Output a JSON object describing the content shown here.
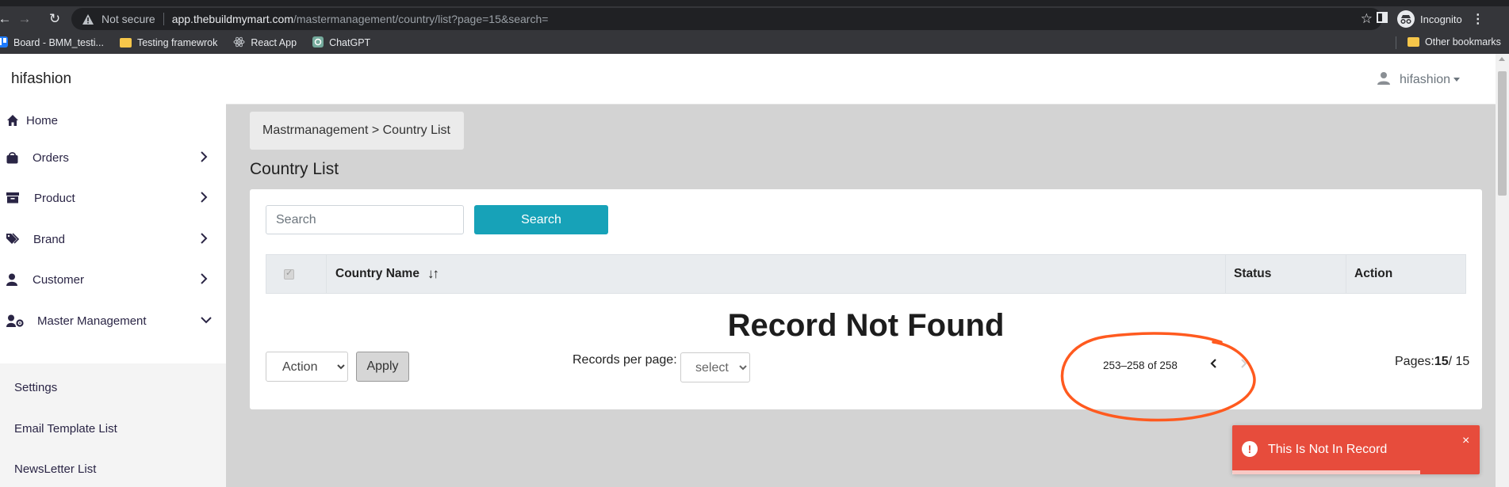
{
  "browser": {
    "security_text": "Not secure",
    "url_host": "app.thebuildmymart.com",
    "url_path": "/mastermanagement/country/list?page=15&search=",
    "profile_label": "Incognito",
    "bookmarks": [
      {
        "label": "Board - BMM_testi...",
        "icon": "trello-icon"
      },
      {
        "label": "Testing framewrok",
        "icon": "folder-icon"
      },
      {
        "label": "React App",
        "icon": "react-icon"
      },
      {
        "label": "ChatGPT",
        "icon": "chatgpt-icon"
      }
    ],
    "other_bookmarks": "Other bookmarks"
  },
  "header": {
    "brand": "hifashion",
    "user_name": "hifashion"
  },
  "sidebar": {
    "items": [
      {
        "label": "Home",
        "icon": "home-icon"
      },
      {
        "label": "Orders",
        "icon": "shopping-bag-icon"
      },
      {
        "label": "Product",
        "icon": "archive-box-icon"
      },
      {
        "label": "Brand",
        "icon": "tags-icon"
      },
      {
        "label": "Customer",
        "icon": "user-icon"
      },
      {
        "label": "Master Management",
        "icon": "user-gear-icon"
      }
    ],
    "submenu": [
      {
        "label": "Settings"
      },
      {
        "label": "Email Template List"
      },
      {
        "label": "NewsLetter List"
      }
    ]
  },
  "main": {
    "breadcrumb": "Mastrmanagement > Country List",
    "title": "Country List",
    "search_placeholder": "Search",
    "search_button": "Search",
    "table": {
      "columns": [
        "Country Name",
        "Status",
        "Action"
      ]
    },
    "empty_message": "Record Not Found",
    "bulk_action": {
      "selected": "Action",
      "apply_label": "Apply"
    },
    "records_per_page_label": "Records per page:",
    "records_per_page_value": "select",
    "range_text": "253–258 of 258",
    "pages_label": "Pages:",
    "current_page": "15",
    "total_pages": "/ 15"
  },
  "toast": {
    "message": "This Is Not In Record",
    "close": "×",
    "progress": 0.76
  },
  "colors": {
    "accent": "#17a2b8",
    "toast": "#e74c3c",
    "annotation": "#ff5a1f",
    "sidebar_text": "#2a2545"
  }
}
